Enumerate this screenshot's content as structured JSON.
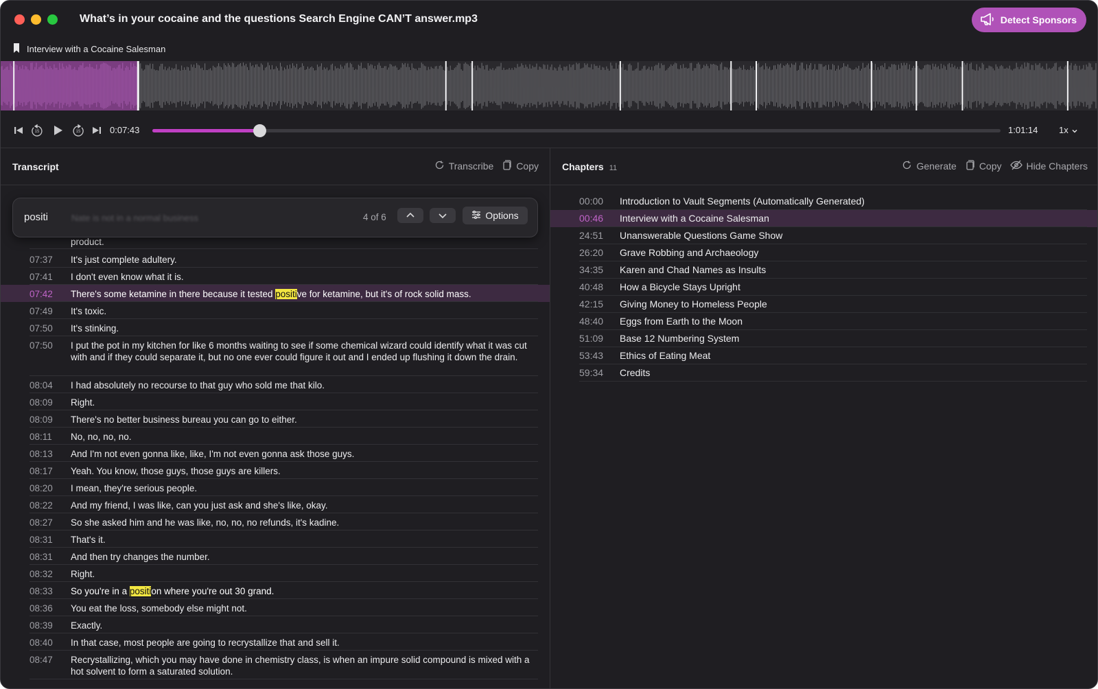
{
  "window": {
    "title": "What’s in your cocaine and the questions Search Engine CAN’T answer.mp3",
    "detect_sponsors_label": "Detect Sponsors",
    "current_chapter": "Interview with a Cocaine Salesman"
  },
  "player": {
    "current_time": "0:07:43",
    "total_time": "1:01:14",
    "progress": 0.127,
    "speed": "1x",
    "waveform_played_fraction": 0.125,
    "chapter_marker_fractions": [
      0.012,
      0.125,
      0.406,
      0.43,
      0.565,
      0.666,
      0.689,
      0.794,
      0.835,
      0.877,
      0.973
    ]
  },
  "transcript": {
    "title": "Transcript",
    "transcribe_label": "Transcribe",
    "copy_label": "Copy",
    "search": {
      "query": "positi",
      "ghost_text": "Nate is not in a normal business",
      "match_count": "4 of 6",
      "options_label": "Options"
    },
    "rows": [
      {
        "time": "",
        "text": "product."
      },
      {
        "time": "07:37",
        "text": "It's just complete adultery."
      },
      {
        "time": "07:41",
        "text": "I don't even know what it is."
      },
      {
        "time": "07:42",
        "pre": "There's some ketamine in there because it tested ",
        "match": "positi",
        "post": "ve for ketamine, but it's of rock solid mass.",
        "active": true
      },
      {
        "time": "07:49",
        "text": "It's toxic."
      },
      {
        "time": "07:50",
        "text": "It's stinking."
      },
      {
        "time": "07:50",
        "text": "I put the pot in my kitchen for like 6 months waiting to see if some chemical wizard could identify what it was cut with and if they could separate it, but no one ever could figure it out and I ended up flushing it down the drain."
      },
      {
        "time": "08:04",
        "text": "I had absolutely no recourse to that guy who sold me that kilo."
      },
      {
        "time": "08:09",
        "text": "Right."
      },
      {
        "time": "08:09",
        "text": "There's no better business bureau you can go to either."
      },
      {
        "time": "08:11",
        "text": "No, no, no, no."
      },
      {
        "time": "08:13",
        "text": "And I'm not even gonna like, like, I'm not even gonna ask those guys."
      },
      {
        "time": "08:17",
        "text": "Yeah. You know, those guys, those guys are killers."
      },
      {
        "time": "08:20",
        "text": "I mean, they're serious people."
      },
      {
        "time": "08:22",
        "text": "And my friend, I was like, can you just ask and she's like, okay."
      },
      {
        "time": "08:27",
        "text": "So she asked him and he was like, no, no, no refunds, it's kadine."
      },
      {
        "time": "08:31",
        "text": "That's it."
      },
      {
        "time": "08:31",
        "text": "And then try changes the number."
      },
      {
        "time": "08:32",
        "text": "Right."
      },
      {
        "time": "08:33",
        "pre": "So you're in a ",
        "match": "positi",
        "post": "on where you're out 30 grand."
      },
      {
        "time": "08:36",
        "text": "You eat the loss, somebody else might not."
      },
      {
        "time": "08:39",
        "text": "Exactly."
      },
      {
        "time": "08:40",
        "text": "In that case, most people are going to recrystallize that and sell it."
      },
      {
        "time": "08:47",
        "text": "Recrystallizing, which you may have done in chemistry class, is when an impure solid compound is mixed with a hot solvent to form a saturated solution."
      }
    ]
  },
  "chapters": {
    "title": "Chapters",
    "count": "11",
    "generate_label": "Generate",
    "copy_label": "Copy",
    "hide_label": "Hide Chapters",
    "items": [
      {
        "time": "00:00",
        "title": "Introduction to Vault Segments (Automatically Generated)"
      },
      {
        "time": "00:46",
        "title": "Interview with a Cocaine Salesman",
        "active": true
      },
      {
        "time": "24:51",
        "title": "Unanswerable Questions Game Show"
      },
      {
        "time": "26:20",
        "title": "Grave Robbing and Archaeology"
      },
      {
        "time": "34:35",
        "title": "Karen and Chad Names as Insults"
      },
      {
        "time": "40:48",
        "title": "How a Bicycle Stays Upright"
      },
      {
        "time": "42:15",
        "title": "Giving Money to Homeless People"
      },
      {
        "time": "48:40",
        "title": "Eggs from Earth to the Moon"
      },
      {
        "time": "51:09",
        "title": "Base 12 Numbering System"
      },
      {
        "time": "53:43",
        "title": "Ethics of Eating Meat"
      },
      {
        "time": "59:34",
        "title": "Credits"
      }
    ]
  }
}
